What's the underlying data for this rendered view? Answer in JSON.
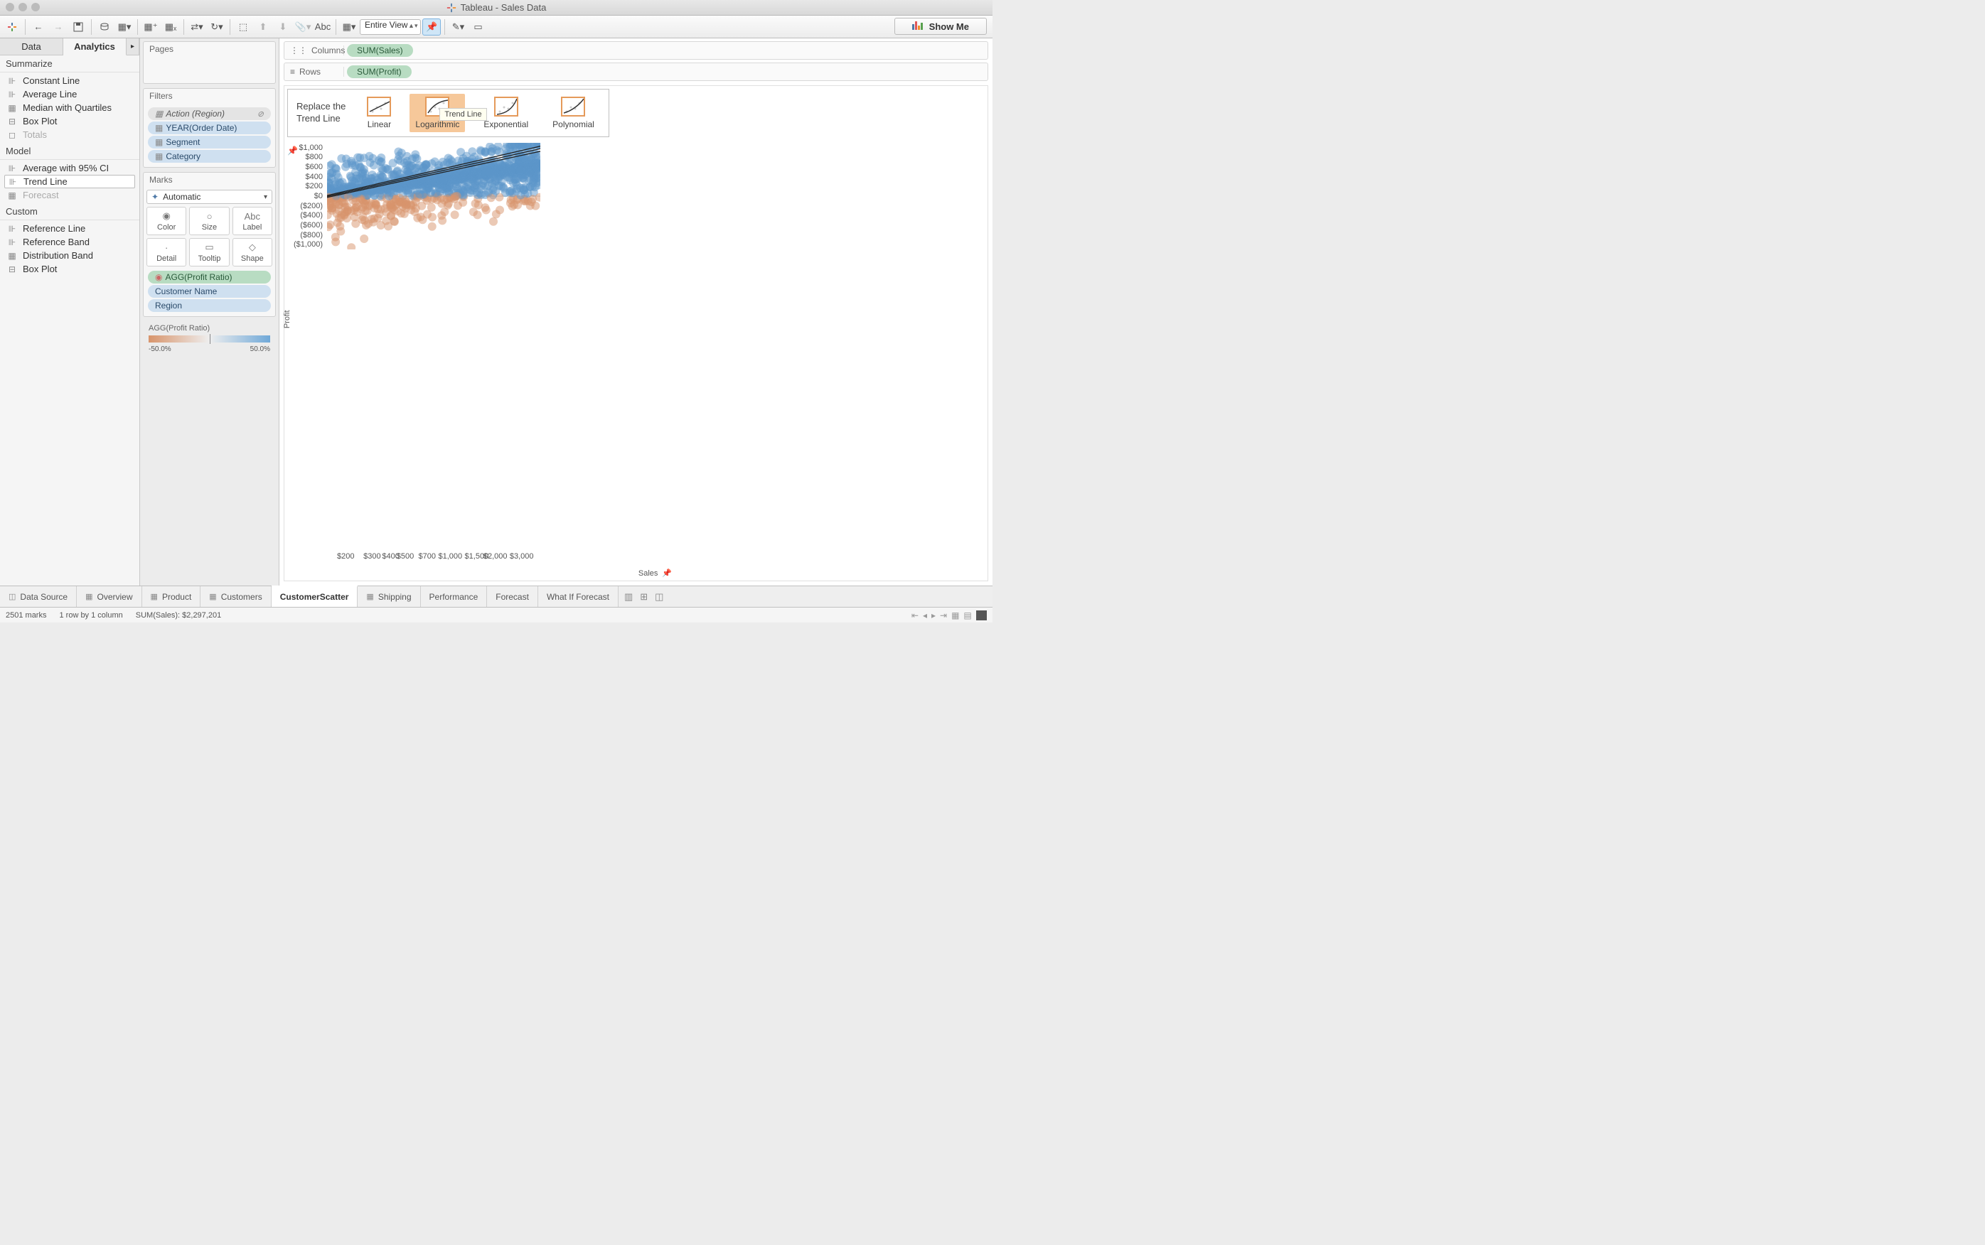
{
  "window": {
    "title": "Tableau - Sales Data"
  },
  "toolbar": {
    "view_mode": "Entire View",
    "showme": "Show Me"
  },
  "side_tabs": {
    "data": "Data",
    "analytics": "Analytics"
  },
  "analytics": {
    "summarize_h": "Summarize",
    "summarize": [
      "Constant Line",
      "Average Line",
      "Median with Quartiles",
      "Box Plot",
      "Totals"
    ],
    "model_h": "Model",
    "model": [
      "Average with 95% CI",
      "Trend Line",
      "Forecast"
    ],
    "model_selected_index": 1,
    "model_disabled": [
      2
    ],
    "custom_h": "Custom",
    "custom": [
      "Reference Line",
      "Reference Band",
      "Distribution Band",
      "Box Plot"
    ]
  },
  "cards": {
    "pages_h": "Pages",
    "filters_h": "Filters",
    "filters": [
      {
        "label": "Action (Region)",
        "style": "grey",
        "glyph": "⊘"
      },
      {
        "label": "YEAR(Order Date)",
        "style": "blue"
      },
      {
        "label": "Segment",
        "style": "blue"
      },
      {
        "label": "Category",
        "style": "blue"
      }
    ],
    "marks_h": "Marks",
    "marks_type": "Automatic",
    "mark_cells": [
      "Color",
      "Size",
      "Label",
      "Detail",
      "Tooltip",
      "Shape"
    ],
    "mark_pills": [
      {
        "label": "AGG(Profit Ratio)",
        "style": "green",
        "icon": "color"
      },
      {
        "label": "Customer Name",
        "style": "blue"
      },
      {
        "label": "Region",
        "style": "blue"
      }
    ],
    "legend_title": "AGG(Profit Ratio)",
    "legend_min": "-50.0%",
    "legend_max": "50.0%"
  },
  "shelves": {
    "columns_label": "Columns",
    "columns_pill": "SUM(Sales)",
    "rows_label": "Rows",
    "rows_pill": "SUM(Profit)"
  },
  "trend": {
    "replace_line1": "Replace the",
    "replace_line2": "Trend Line",
    "options": [
      "Linear",
      "Logarithmic",
      "Exponential",
      "Polynomial"
    ],
    "tooltip": "Trend Line",
    "drag_index": 1
  },
  "chart_data": {
    "type": "scatter",
    "xlabel": "Sales",
    "ylabel": "Profit",
    "x_ticks": [
      "$200",
      "$300",
      "$400",
      "$500",
      "$700",
      "$1,000",
      "$1,500",
      "$2,000",
      "$3,000"
    ],
    "x_tick_values": [
      200,
      300,
      400,
      500,
      700,
      1000,
      1500,
      2000,
      3000
    ],
    "y_ticks": [
      "$1,000",
      "$800",
      "$600",
      "$400",
      "$200",
      "$0",
      "($200)",
      "($400)",
      "($600)",
      "($800)",
      "($1,000)"
    ],
    "y_tick_values": [
      1000,
      800,
      600,
      400,
      200,
      0,
      -200,
      -400,
      -600,
      -800,
      -1000
    ],
    "x_scale": "log",
    "x_range": [
      150,
      4000
    ],
    "y_range": [
      -1100,
      1100
    ],
    "color_field": "Profit Ratio",
    "color_range": [
      -0.5,
      0.5
    ],
    "color_low": "#d8946b",
    "color_high": "#5c96c9",
    "trend_lines": [
      {
        "kind": "log",
        "a": 310,
        "b": -1540
      },
      {
        "kind": "log",
        "a": 300,
        "b": -1510
      },
      {
        "kind": "log",
        "a": 290,
        "b": -1480
      }
    ],
    "approx_marks": 2501
  },
  "sheets": {
    "data_source": "Data Source",
    "tabs": [
      "Overview",
      "Product",
      "Customers",
      "CustomerScatter",
      "Shipping",
      "Performance",
      "Forecast",
      "What If Forecast"
    ],
    "active_index": 3
  },
  "status": {
    "marks": "2501 marks",
    "layout": "1 row by 1 column",
    "sum": "SUM(Sales): $2,297,201"
  }
}
